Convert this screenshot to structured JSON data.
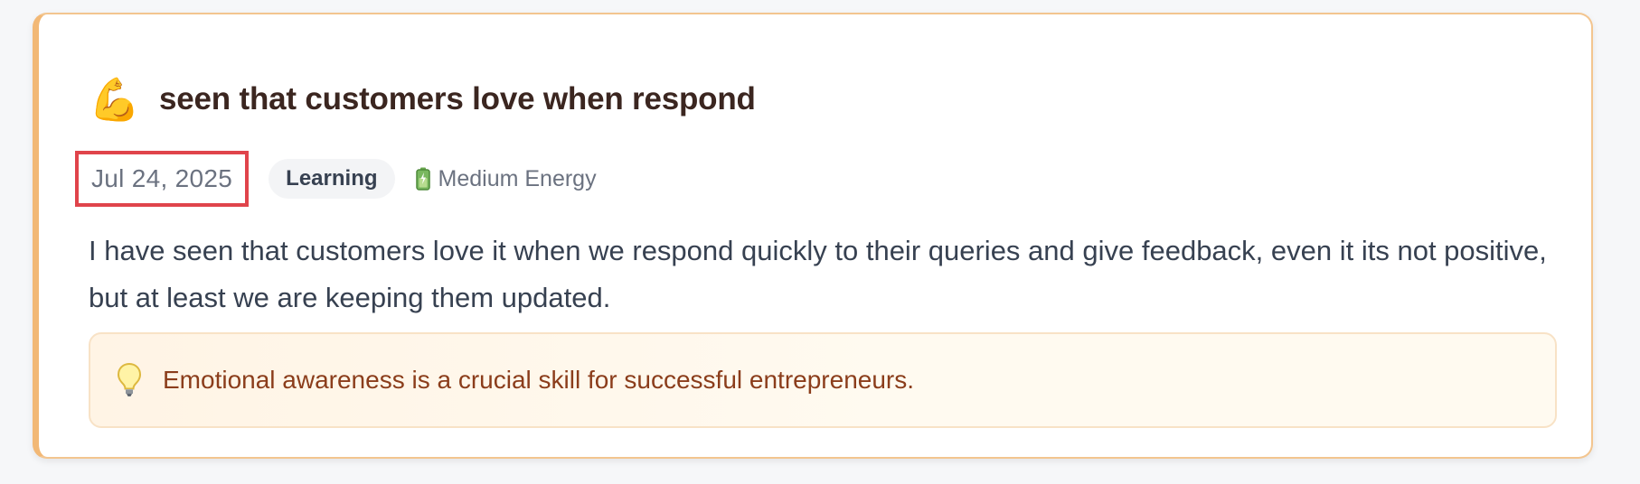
{
  "entry": {
    "title": "seen that customers love when respond",
    "title_icon": "flexed-biceps-icon",
    "date": "Jul 24, 2025",
    "category": "Learning",
    "energy_icon": "battery-icon",
    "energy": "Medium Energy",
    "body": "I have seen that customers love it when we respond quickly to their queries and give feedback, even it its not positive, but at least we are keeping them updated.",
    "tip_icon": "lightbulb-icon",
    "tip": "Emotional awareness is a crucial skill for successful entrepreneurs."
  },
  "colors": {
    "card_border": "#f3c58f",
    "date_highlight": "#e0444b",
    "title": "#3b2620",
    "tip_text": "#8b3d1b",
    "tip_background": "#fff4e5"
  }
}
